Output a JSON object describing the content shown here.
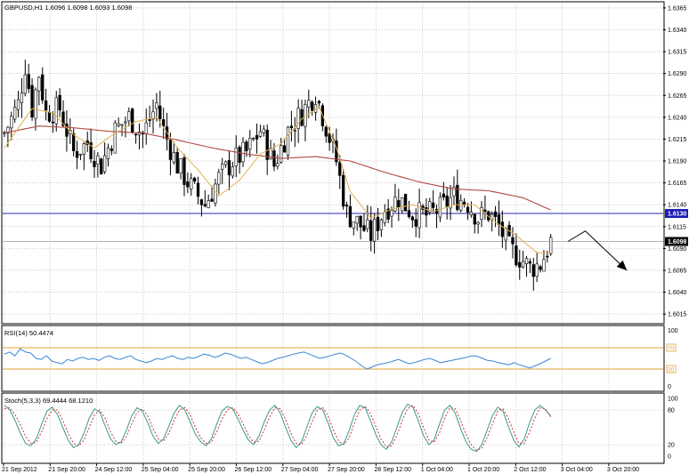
{
  "colors": {
    "background": "#ffffff",
    "grid": "#c8c8c8",
    "candle": "#000000",
    "ma_short": "#e0b050",
    "ma_long": "#b04a3e",
    "hline_blue": "#2a2ab0",
    "hline_gray": "#b4b4b4",
    "rsi_line": "#3a86d6",
    "rsi_levels": "#e0a030",
    "stoch_main": "#3a9a8a",
    "stoch_signal": "#d03030",
    "price_tag_blue": "#1a1ab4",
    "price_tag_black": "#000000"
  },
  "chart_data": [
    {
      "type": "candlestick",
      "title": "GBPUSD,H1  1.6096 1.6098 1.6093 1.6098",
      "ylim": [
        1.6005,
        1.637
      ],
      "grid": true,
      "y_ticks": [
        "1.6365",
        "1.6340",
        "1.6315",
        "1.6290",
        "1.6265",
        "1.6240",
        "1.6215",
        "1.6190",
        "1.6165",
        "1.6140",
        "1.6115",
        "1.6090",
        "1.6065",
        "1.6040",
        "1.6015"
      ],
      "x_ticks": [
        "21 Sep 2012",
        "21 Sep 20:00",
        "24 Sep 12:00",
        "25 Sep 04:00",
        "25 Sep 20:00",
        "26 Sep 12:00",
        "27 Sep 04:00",
        "27 Sep 20:00",
        "28 Sep 12:00",
        "1 Oct 04:00",
        "1 Oct 20:00",
        "2 Oct 12:00",
        "3 Oct 04:00",
        "3 Oct 20:00"
      ],
      "price_tags": [
        {
          "value": 1.613,
          "label": "1.6130",
          "style": "blue"
        },
        {
          "value": 1.6098,
          "label": "1.6098",
          "style": "black"
        }
      ],
      "horizontal_lines": [
        {
          "value": 1.613,
          "style": "blue"
        },
        {
          "value": 1.6098,
          "style": "gray"
        }
      ],
      "close_path": [
        {
          "bar": 0,
          "close": 1.6222
        },
        {
          "bar": 4,
          "close": 1.6255
        },
        {
          "bar": 6,
          "close": 1.63
        },
        {
          "bar": 8,
          "close": 1.625
        },
        {
          "bar": 10,
          "close": 1.629
        },
        {
          "bar": 12,
          "close": 1.6245
        },
        {
          "bar": 16,
          "close": 1.625
        },
        {
          "bar": 20,
          "close": 1.62
        },
        {
          "bar": 24,
          "close": 1.621
        },
        {
          "bar": 28,
          "close": 1.6185
        },
        {
          "bar": 32,
          "close": 1.6225
        },
        {
          "bar": 36,
          "close": 1.624
        },
        {
          "bar": 40,
          "close": 1.622
        },
        {
          "bar": 44,
          "close": 1.6255
        },
        {
          "bar": 46,
          "close": 1.6225
        },
        {
          "bar": 50,
          "close": 1.6185
        },
        {
          "bar": 54,
          "close": 1.616
        },
        {
          "bar": 58,
          "close": 1.614
        },
        {
          "bar": 62,
          "close": 1.617
        },
        {
          "bar": 66,
          "close": 1.619
        },
        {
          "bar": 70,
          "close": 1.62
        },
        {
          "bar": 74,
          "close": 1.6225
        },
        {
          "bar": 78,
          "close": 1.6185
        },
        {
          "bar": 82,
          "close": 1.6225
        },
        {
          "bar": 86,
          "close": 1.6245
        },
        {
          "bar": 90,
          "close": 1.6268
        },
        {
          "bar": 93,
          "close": 1.623
        },
        {
          "bar": 96,
          "close": 1.619
        },
        {
          "bar": 99,
          "close": 1.613
        },
        {
          "bar": 102,
          "close": 1.612
        },
        {
          "bar": 106,
          "close": 1.6105
        },
        {
          "bar": 110,
          "close": 1.6135
        },
        {
          "bar": 114,
          "close": 1.6148
        },
        {
          "bar": 118,
          "close": 1.613
        },
        {
          "bar": 122,
          "close": 1.6128
        },
        {
          "bar": 126,
          "close": 1.6135
        },
        {
          "bar": 130,
          "close": 1.615
        },
        {
          "bar": 134,
          "close": 1.6142
        },
        {
          "bar": 137,
          "close": 1.6125
        },
        {
          "bar": 140,
          "close": 1.613
        },
        {
          "bar": 143,
          "close": 1.6115
        },
        {
          "bar": 146,
          "close": 1.609
        },
        {
          "bar": 149,
          "close": 1.608
        },
        {
          "bar": 152,
          "close": 1.6068
        },
        {
          "bar": 155,
          "close": 1.6072
        },
        {
          "bar": 158,
          "close": 1.6098
        }
      ],
      "ma_short": [
        {
          "bar": 0,
          "v": 1.6205
        },
        {
          "bar": 8,
          "v": 1.625
        },
        {
          "bar": 14,
          "v": 1.6245
        },
        {
          "bar": 20,
          "v": 1.622
        },
        {
          "bar": 26,
          "v": 1.6205
        },
        {
          "bar": 32,
          "v": 1.6222
        },
        {
          "bar": 38,
          "v": 1.6235
        },
        {
          "bar": 44,
          "v": 1.624
        },
        {
          "bar": 50,
          "v": 1.6205
        },
        {
          "bar": 56,
          "v": 1.618
        },
        {
          "bar": 62,
          "v": 1.615
        },
        {
          "bar": 68,
          "v": 1.6168
        },
        {
          "bar": 74,
          "v": 1.6198
        },
        {
          "bar": 80,
          "v": 1.621
        },
        {
          "bar": 86,
          "v": 1.6238
        },
        {
          "bar": 91,
          "v": 1.6252
        },
        {
          "bar": 96,
          "v": 1.6205
        },
        {
          "bar": 100,
          "v": 1.6155
        },
        {
          "bar": 106,
          "v": 1.6125
        },
        {
          "bar": 112,
          "v": 1.6135
        },
        {
          "bar": 118,
          "v": 1.614
        },
        {
          "bar": 124,
          "v": 1.6132
        },
        {
          "bar": 130,
          "v": 1.614
        },
        {
          "bar": 136,
          "v": 1.614
        },
        {
          "bar": 142,
          "v": 1.612
        },
        {
          "bar": 148,
          "v": 1.6105
        },
        {
          "bar": 154,
          "v": 1.6085
        },
        {
          "bar": 158,
          "v": 1.6085
        }
      ],
      "ma_long": [
        {
          "bar": 0,
          "v": 1.6222
        },
        {
          "bar": 10,
          "v": 1.623
        },
        {
          "bar": 20,
          "v": 1.6228
        },
        {
          "bar": 30,
          "v": 1.6224
        },
        {
          "bar": 40,
          "v": 1.6222
        },
        {
          "bar": 50,
          "v": 1.6214
        },
        {
          "bar": 60,
          "v": 1.6205
        },
        {
          "bar": 70,
          "v": 1.6198
        },
        {
          "bar": 80,
          "v": 1.6193
        },
        {
          "bar": 90,
          "v": 1.6195
        },
        {
          "bar": 100,
          "v": 1.619
        },
        {
          "bar": 110,
          "v": 1.6177
        },
        {
          "bar": 120,
          "v": 1.6166
        },
        {
          "bar": 130,
          "v": 1.6158
        },
        {
          "bar": 140,
          "v": 1.6156
        },
        {
          "bar": 150,
          "v": 1.6148
        },
        {
          "bar": 158,
          "v": 1.6134
        }
      ],
      "arrow": [
        {
          "bar": 163,
          "v": 1.6098
        },
        {
          "bar": 168,
          "v": 1.611
        },
        {
          "bar": 180,
          "v": 1.6065
        }
      ]
    },
    {
      "type": "line",
      "title": "RSI(14) 50.4474",
      "ylim": [
        0,
        100
      ],
      "y_ticks": [
        "100",
        "0"
      ],
      "level_labels": [
        "70",
        "30"
      ],
      "levels": [
        70,
        30
      ],
      "values": [
        58,
        62,
        55,
        68,
        62,
        60,
        50,
        48,
        55,
        45,
        42,
        40,
        48,
        45,
        50,
        52,
        48,
        50,
        46,
        52,
        55,
        50,
        48,
        52,
        55,
        48,
        45,
        42,
        45,
        50,
        48,
        52,
        55,
        50,
        48,
        52,
        50,
        54,
        58,
        56,
        52,
        55,
        60,
        58,
        54,
        50,
        52,
        48,
        44,
        40,
        42,
        46,
        50,
        52,
        55,
        58,
        60,
        62,
        58,
        54,
        50,
        52,
        55,
        58,
        60,
        56,
        50,
        44,
        36,
        30,
        34,
        38,
        40,
        42,
        45,
        48,
        44,
        40,
        42,
        45,
        48,
        50,
        46,
        42,
        44,
        46,
        48,
        50,
        52,
        55,
        54,
        50,
        46,
        45,
        42,
        40,
        38,
        42,
        38,
        35,
        32,
        36,
        40,
        45,
        50
      ]
    },
    {
      "type": "line",
      "title": "Stoch(5,3,3) 69.4444 68.1210",
      "ylim": [
        0,
        100
      ],
      "y_ticks": [
        "100",
        "80",
        "20",
        "0"
      ],
      "series": [
        {
          "values": [
            88,
            80,
            62,
            40,
            22,
            18,
            30,
            55,
            78,
            85,
            72,
            50,
            28,
            15,
            20,
            40,
            66,
            82,
            76,
            52,
            30,
            20,
            25,
            45,
            70,
            84,
            78,
            58,
            35,
            22,
            30,
            52,
            75,
            88,
            80,
            60,
            38,
            25,
            18,
            30,
            55,
            78,
            86,
            82,
            65,
            45,
            28,
            20,
            35,
            60,
            80,
            88,
            75,
            50,
            28,
            15,
            25,
            50,
            75,
            86,
            80,
            58,
            32,
            18,
            22,
            45,
            72,
            88,
            84,
            62,
            38,
            20,
            12,
            25,
            50,
            76,
            90,
            85,
            62,
            36,
            20,
            28,
            55,
            80,
            88,
            74,
            48,
            25,
            12,
            8,
            20,
            45,
            70,
            85,
            78,
            52,
            28,
            16,
            30,
            58,
            80,
            88,
            80,
            70
          ]
        },
        {
          "values": [
            82,
            84,
            72,
            55,
            34,
            22,
            24,
            42,
            65,
            80,
            80,
            62,
            40,
            22,
            18,
            28,
            50,
            72,
            80,
            65,
            42,
            26,
            22,
            34,
            56,
            76,
            82,
            70,
            48,
            30,
            26,
            40,
            62,
            80,
            84,
            72,
            50,
            32,
            22,
            24,
            42,
            64,
            80,
            84,
            74,
            56,
            36,
            24,
            26,
            46,
            68,
            84,
            82,
            64,
            40,
            22,
            20,
            36,
            60,
            80,
            84,
            70,
            46,
            26,
            20,
            32,
            58,
            80,
            86,
            74,
            52,
            30,
            16,
            18,
            36,
            62,
            82,
            88,
            74,
            50,
            28,
            24,
            40,
            66,
            84,
            82,
            62,
            38,
            20,
            10,
            14,
            32,
            56,
            78,
            82,
            66,
            42,
            22,
            22,
            42,
            66,
            84,
            82,
            68
          ]
        }
      ]
    }
  ]
}
